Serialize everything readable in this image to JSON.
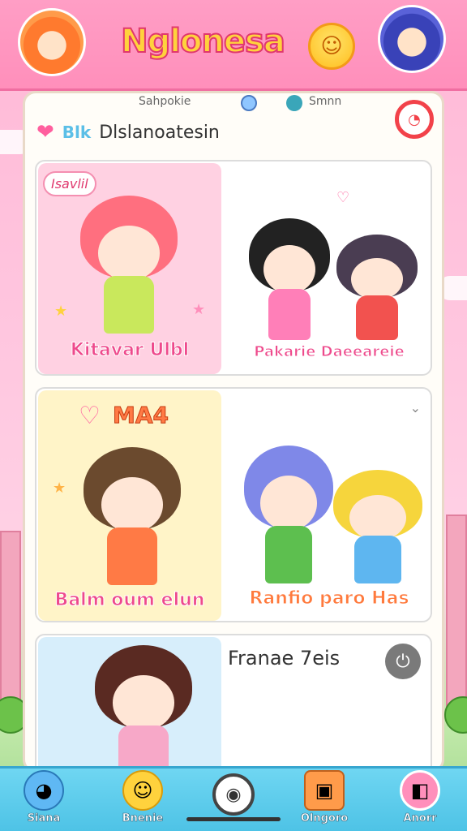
{
  "header": {
    "app_title": "Nglonesa",
    "left_avatar_icon": "boy-avatar-icon",
    "right_avatar_icon": "girl-avatar-icon",
    "mascot_icon": "smiley-mascot-icon"
  },
  "tabs": [
    {
      "label": "Sahpokie"
    },
    {
      "label": "Smnn"
    }
  ],
  "section": {
    "tag": "Blk",
    "title": "Dlslanoatesin"
  },
  "cards": [
    {
      "left_label": "Kitavar Ulbl",
      "left_bubble": "Isavlil",
      "right_label": "Pakarie Daeeareie"
    },
    {
      "badge": "MA4",
      "left_label": "Balm oum elun",
      "right_label": "Ranfio paro Has"
    },
    {
      "title": "Franae 7eis"
    }
  ],
  "bottom_nav": {
    "items": [
      {
        "label": "Siana",
        "icon": "earth-icon"
      },
      {
        "label": "Bnenie",
        "icon": "chick-icon"
      },
      {
        "label": "Olngoro",
        "icon": "gift-box-icon"
      },
      {
        "label": "Anorr",
        "icon": "package-icon"
      }
    ],
    "center_icon": "camera-icon"
  },
  "colors": {
    "header_pink": "#ff8fbb",
    "nav_blue": "#4ec3e6",
    "title_yellow": "#ffd23d",
    "label_pink": "#ee4a8c",
    "label_orange": "#ff7a3d"
  }
}
